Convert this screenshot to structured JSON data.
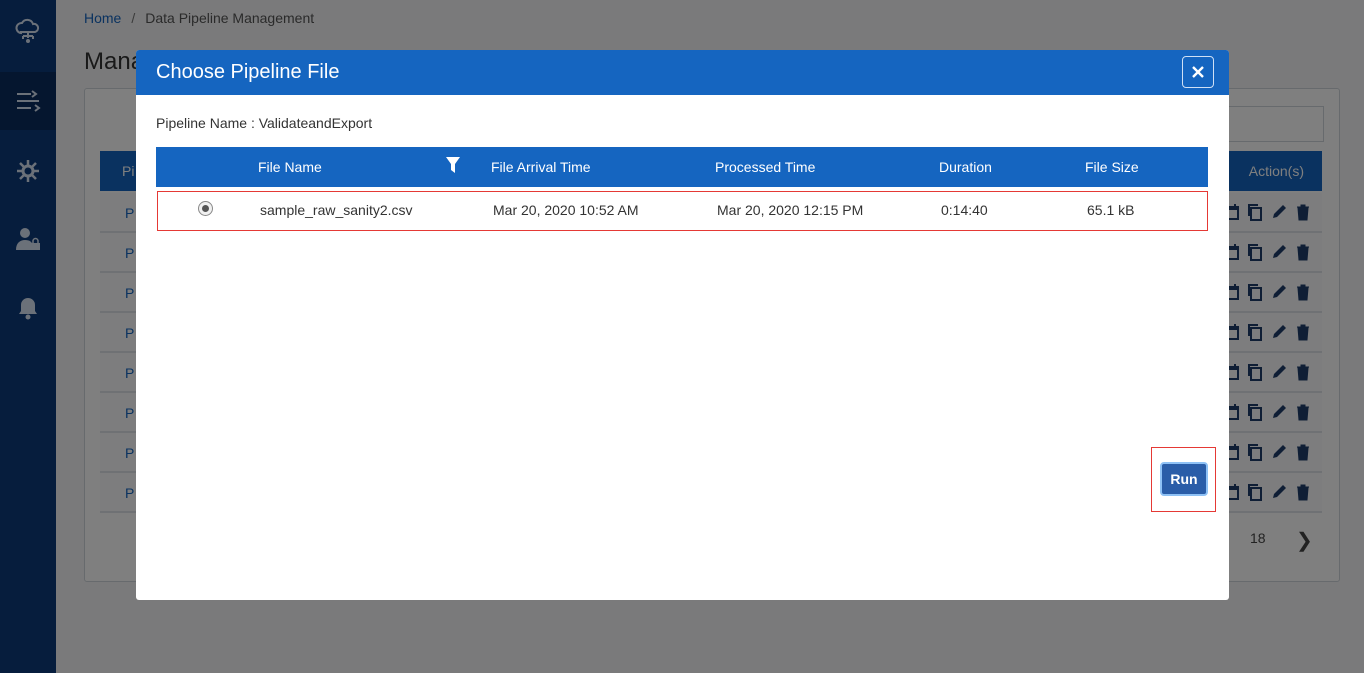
{
  "sidebar": {
    "items": [
      {
        "icon": "cloud-network-icon"
      },
      {
        "icon": "pipeline-icon",
        "active": true
      },
      {
        "icon": "gear-wrench-icon"
      },
      {
        "icon": "user-lock-icon"
      },
      {
        "icon": "bell-icon"
      }
    ]
  },
  "breadcrumb": {
    "home": "Home",
    "separator": "/",
    "current": "Data Pipeline Management"
  },
  "page": {
    "title_partial": "Mana"
  },
  "background_table": {
    "header_first": "Pi",
    "header_actions": "Action(s)",
    "row_prefix": "P",
    "row_count": 8
  },
  "pager": {
    "ellipsis": ". . .",
    "last_page": "18"
  },
  "modal": {
    "title": "Choose Pipeline File",
    "pipeline_label": "Pipeline Name : ValidateandExport",
    "columns": [
      "File Name",
      "File Arrival Time",
      "Processed Time",
      "Duration",
      "File Size"
    ],
    "rows": [
      {
        "selected": true,
        "file_name": "sample_raw_sanity2.csv",
        "arrival": "Mar 20, 2020 10:52 AM",
        "processed": "Mar 20, 2020 12:15 PM",
        "duration": "0:14:40",
        "size": "65.1 kB"
      }
    ],
    "run_label": "Run"
  },
  "colors": {
    "primary": "#1565c0",
    "sidebar": "#0d3a7a",
    "highlight": "#e53935"
  }
}
